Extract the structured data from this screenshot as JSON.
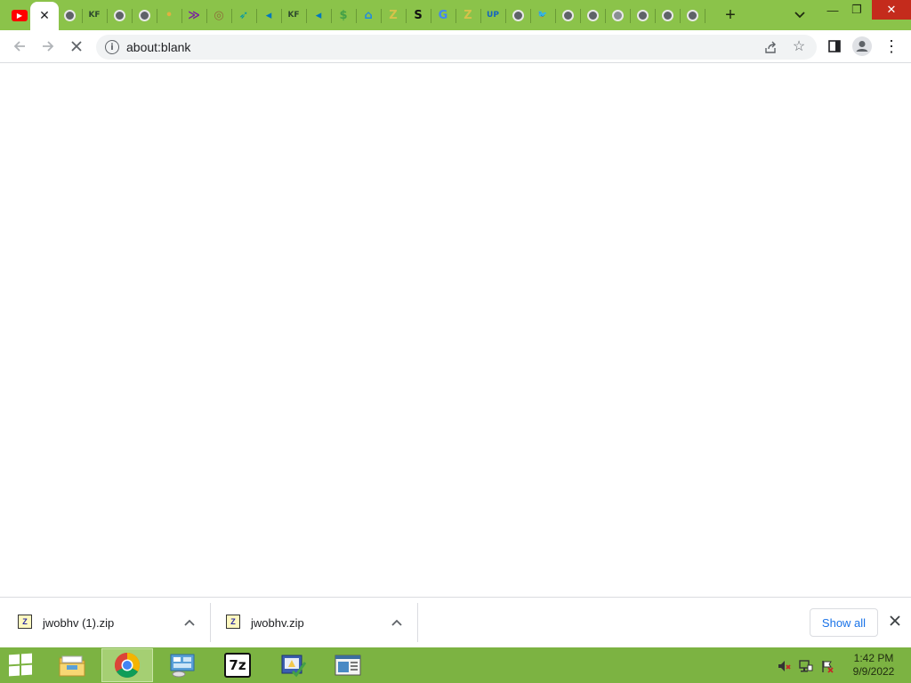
{
  "tabs": [
    {
      "icon": "youtube-icon",
      "glyph": "▶",
      "color": "#ff0000"
    },
    {
      "icon": "close-icon",
      "glyph": "✕",
      "color": "#202124",
      "active": true
    },
    {
      "icon": "globe-icon",
      "glyph": "",
      "color": "#5f6368"
    },
    {
      "icon": "kf-icon",
      "glyph": "KF",
      "color": "#2e4a2e"
    },
    {
      "icon": "globe-icon",
      "glyph": "",
      "color": "#5f6368"
    },
    {
      "icon": "globe-icon",
      "glyph": "",
      "color": "#5f6368"
    },
    {
      "icon": "bell-icon",
      "glyph": "•",
      "color": "#e0b040"
    },
    {
      "icon": "chevron-stack-icon",
      "glyph": "≫",
      "color": "#7b1fa2"
    },
    {
      "icon": "target-icon",
      "glyph": "◎",
      "color": "#8d6e3a"
    },
    {
      "icon": "rocket-icon",
      "glyph": "➶",
      "color": "#0097a7"
    },
    {
      "icon": "fish-icon",
      "glyph": "◂",
      "color": "#0277bd"
    },
    {
      "icon": "kf-icon",
      "glyph": "KF",
      "color": "#2e4a2e"
    },
    {
      "icon": "fish-icon",
      "glyph": "◂",
      "color": "#0277bd"
    },
    {
      "icon": "dollar-icon",
      "glyph": "$",
      "color": "#43a047"
    },
    {
      "icon": "home-icon",
      "glyph": "⌂",
      "color": "#1e88e5"
    },
    {
      "icon": "archive-icon",
      "glyph": "Z",
      "color": "#d6c24a"
    },
    {
      "icon": "s-icon",
      "glyph": "S",
      "color": "#111111"
    },
    {
      "icon": "google-icon",
      "glyph": "G",
      "color": "#4285f4"
    },
    {
      "icon": "archive-icon",
      "glyph": "Z",
      "color": "#d6c24a"
    },
    {
      "icon": "up-icon",
      "glyph": "UP",
      "color": "#1565c0"
    },
    {
      "icon": "globe-icon",
      "glyph": "",
      "color": "#5f6368"
    },
    {
      "icon": "twitter-icon",
      "glyph": "🐦",
      "color": "#1da1f2"
    },
    {
      "icon": "globe-icon",
      "glyph": "",
      "color": "#5f6368"
    },
    {
      "icon": "globe-icon",
      "glyph": "",
      "color": "#5f6368"
    },
    {
      "icon": "globe-icon",
      "glyph": "",
      "color": "#8a8f94"
    },
    {
      "icon": "globe-icon",
      "glyph": "",
      "color": "#5f6368"
    },
    {
      "icon": "globe-icon",
      "glyph": "",
      "color": "#5f6368"
    },
    {
      "icon": "globe-icon",
      "glyph": "",
      "color": "#5f6368"
    }
  ],
  "toolbar": {
    "url": "about:blank"
  },
  "downloads": [
    {
      "filename": "jwobhv (1).zip"
    },
    {
      "filename": "jwobhv.zip"
    }
  ],
  "shelf": {
    "show_all_label": "Show all"
  },
  "taskbar": {
    "items": [
      {
        "name": "file-explorer",
        "icon": "folder-icon"
      },
      {
        "name": "chrome",
        "icon": "chrome-icon",
        "active": true
      },
      {
        "name": "control-panel",
        "icon": "control-panel-icon"
      },
      {
        "name": "7zip",
        "icon": "7zip-icon",
        "glyph": "7z"
      },
      {
        "name": "setup",
        "icon": "installer-icon"
      },
      {
        "name": "reader",
        "icon": "document-viewer-icon"
      }
    ],
    "clock_time": "1:42 PM",
    "clock_date": "9/9/2022"
  },
  "colors": {
    "chrome_frame": "#8bc34a",
    "taskbar": "#7cb342",
    "link_blue": "#1a73e8"
  }
}
